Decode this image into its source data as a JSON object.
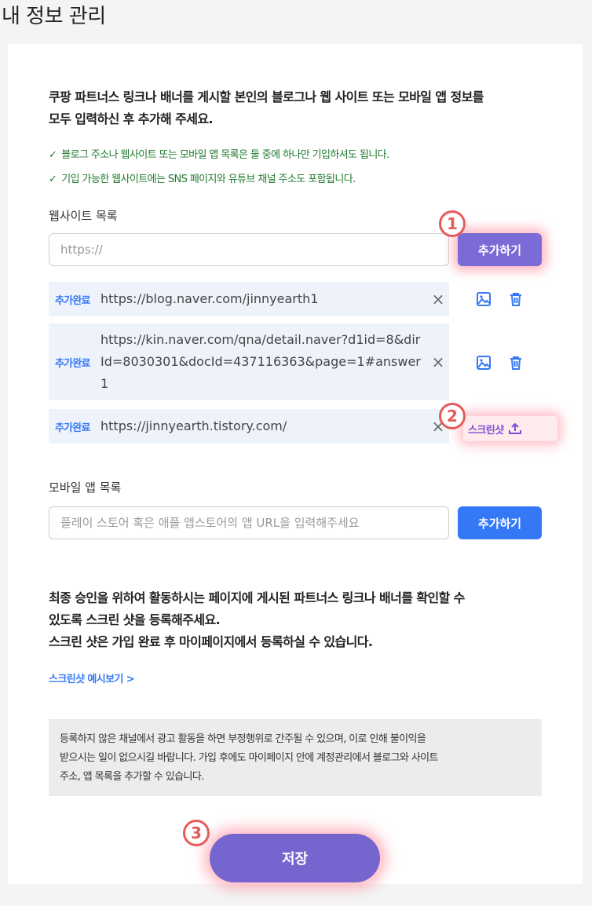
{
  "page": {
    "title": "내 정보 관리"
  },
  "intro": {
    "line1": "쿠팡 파트너스 링크나 배너를 게시할 본인의 블로그나 웹 사이트 또는 모바일 앱 정보를",
    "line2": "모두 입력하신 후 추가해 주세요."
  },
  "checks": [
    "블로그 주소나 웹사이트 또는 모바일 앱 목록은 둘 중에 하나만 기입하셔도 됩니다.",
    "기입 가능한 웹사이트에는 SNS 페이지와 유튜브 채널 주소도 포함됩니다."
  ],
  "check_mark": "✓",
  "website": {
    "label": "웹사이트 목록",
    "input_placeholder": "https://",
    "add_label": "추가하기",
    "items": [
      {
        "tag": "추가완료",
        "url": "https://blog.naver.com/jinnyearth1"
      },
      {
        "tag": "추가완료",
        "url": "https://kin.naver.com/qna/detail.naver?d1id=8&dirId=8030301&docId=437116363&page=1#answer1"
      },
      {
        "tag": "추가완료",
        "url": "https://jinnyearth.tistory.com/"
      }
    ],
    "remove_glyph": "×",
    "screenshot_label": "스크린샷"
  },
  "mobile": {
    "label": "모바일 앱 목록",
    "input_placeholder": "플레이 스토어 혹은 애플 앱스토어의 앱 URL을 입력해주세요",
    "add_label": "추가하기"
  },
  "notice": {
    "line1": "최종 승인을 위하여 활동하시는 페이지에 게시된 파트너스 링크나 배너를 확인할 수",
    "line2": "있도록 스크린 샷을 등록해주세요.",
    "line3": "스크린 샷은 가입 완료 후 마이페이지에서 등록하실 수 있습니다."
  },
  "example_link": "스크린샷 예시보기 >",
  "info": {
    "line1": "등록하지 않은 채널에서 광고 활동을 하면 부정행위로 간주될 수 있으며, 이로 인해 불이익을",
    "line2": "받으시는 일이 없으시길 바랍니다. 가입 후에도 마이페이지 안에 계정관리에서 블로그와 사이트",
    "line3": "주소, 앱 목록을 추가할 수 있습니다."
  },
  "save_label": "저장",
  "markers": [
    "1",
    "2",
    "3"
  ],
  "colors": {
    "accent_purple": "#7a6bd6",
    "accent_blue": "#3478f6",
    "check_green": "#1f7a2e",
    "marker_red": "#e85a5a"
  },
  "icons": [
    "image-icon",
    "trash-icon",
    "upload-icon",
    "close-icon"
  ]
}
